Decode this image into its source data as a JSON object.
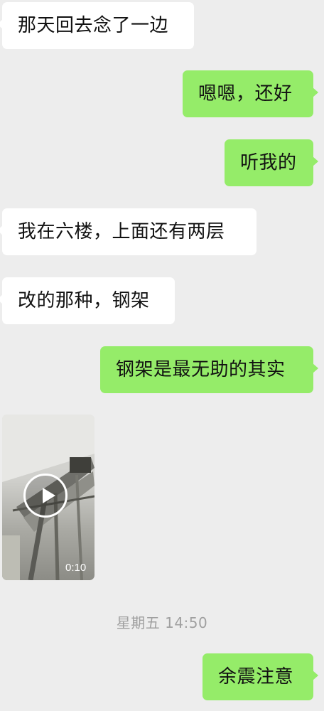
{
  "messages": [
    {
      "side": "left",
      "text": "那天回去念了一边"
    },
    {
      "side": "right",
      "text": "嗯嗯，还好"
    },
    {
      "side": "right",
      "text": "听我的"
    },
    {
      "side": "left",
      "text": "我在六楼，上面还有两层"
    },
    {
      "side": "left",
      "text": "改的那种，钢架"
    },
    {
      "side": "right",
      "text": "钢架是最无助的其实"
    },
    {
      "side": "left",
      "type": "video",
      "duration": "0:10",
      "icon": "play-icon"
    },
    {
      "side": "right",
      "text": "余震注意"
    }
  ],
  "timestamp": "星期五 14:50",
  "colors": {
    "background": "#ededed",
    "incoming_bubble": "#ffffff",
    "outgoing_bubble": "#95ec69",
    "timestamp": "#a0a0a0"
  }
}
